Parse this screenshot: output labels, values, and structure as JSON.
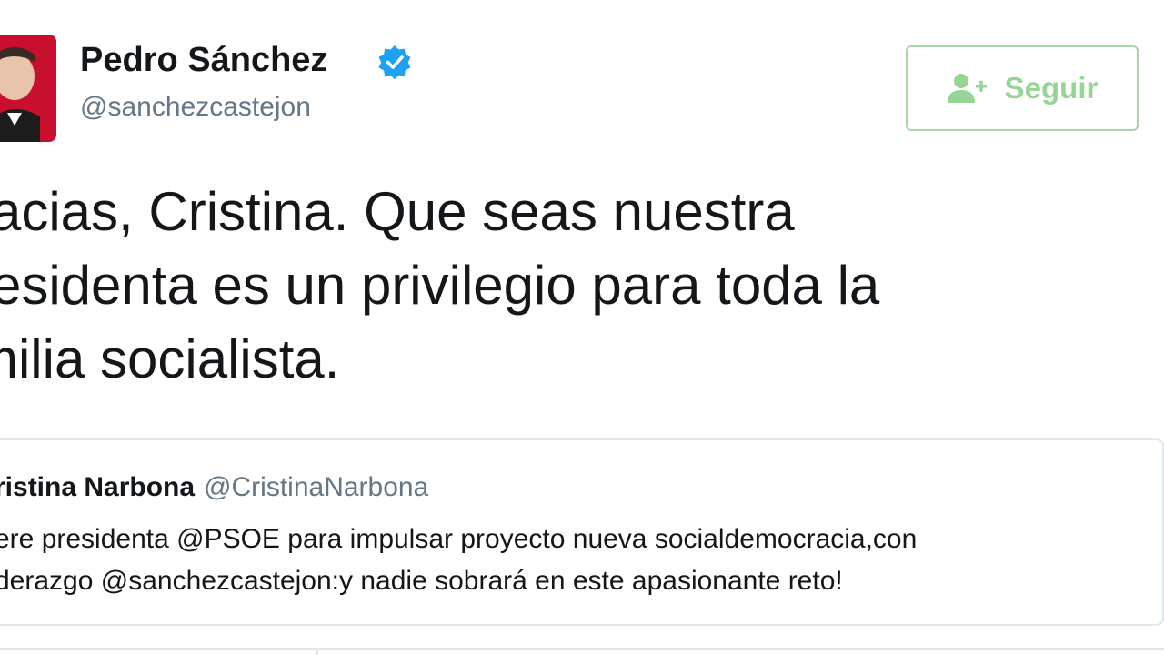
{
  "author": {
    "name": "Pedro Sánchez",
    "handle": "@sanchezcastejon",
    "verified": true
  },
  "follow_button": {
    "label": "Seguir",
    "icon": "add-user-icon",
    "color": "#97d595"
  },
  "tweet": {
    "lines": [
      "racias, Cristina. Que seas nuestra",
      "residenta es un privilegio para toda la",
      "milia socialista."
    ]
  },
  "quoted_tweet": {
    "name": "ristina Narbona",
    "handle": "@CristinaNarbona",
    "lines": [
      "ere presidenta @PSOE para impulsar proyecto nueva socialdemocracia,con",
      "derazgo @sanchezcastejon:y nadie sobrará en este apasionante reto!"
    ]
  },
  "colors": {
    "verified_badge": "#1da1f2",
    "handle_gray": "#657786",
    "border": "#e1e8ed",
    "avatar_bg": "#c8102e"
  }
}
